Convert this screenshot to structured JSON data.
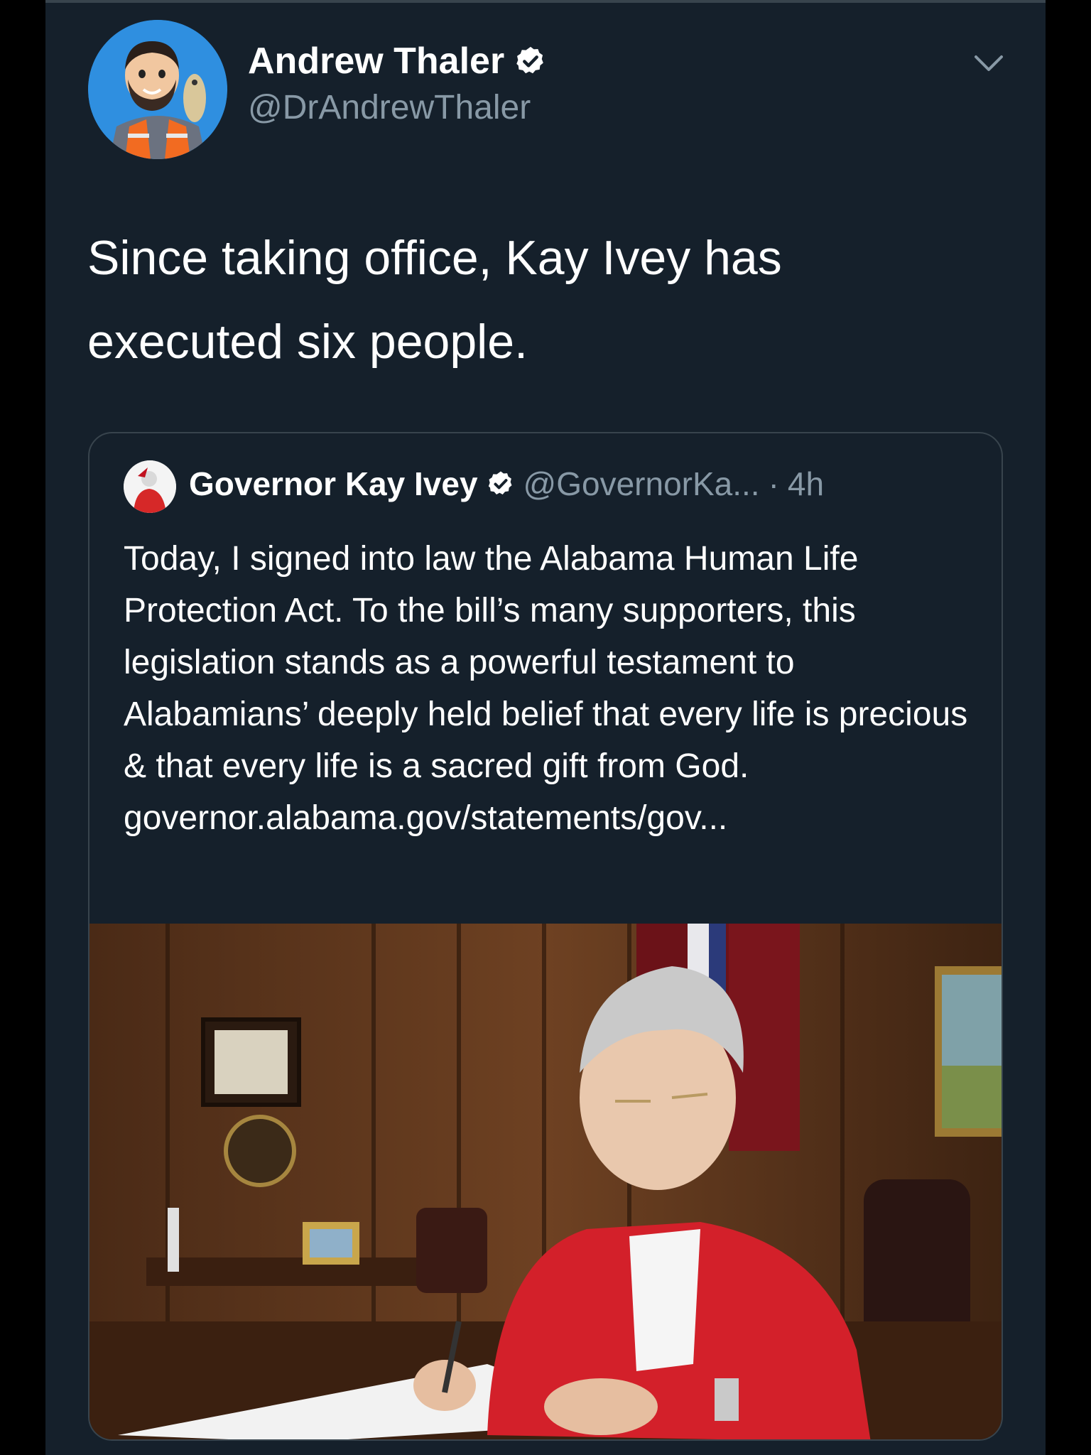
{
  "tweet": {
    "author_name": "Andrew Thaler",
    "author_handle": "@DrAndrewThaler",
    "text": "Since taking office, Kay Ivey has executed six people.",
    "avatar_icon": "cartoon-avatar",
    "verified_icon": "verified-badge-icon",
    "menu_icon": "chevron-down-icon"
  },
  "quoted_tweet": {
    "author_name": "Governor Kay Ivey",
    "author_handle": "@GovernorKa...",
    "separator": "·",
    "time": "4h",
    "text": "Today, I signed into law the Alabama Human Life Protection Act. To the bill’s many supporters, this legislation stands as a powerful testament to Alabamians’ deeply held belief that every life is precious & that every life is a sacred gift from God. governor.alabama.gov/statements/gov...",
    "media": "photo-governor-signing-bill"
  },
  "colors": {
    "background": "#15202b",
    "border": "#38444d",
    "text_primary": "#ffffff",
    "text_secondary": "#8899a6",
    "verified": "#ffffff"
  }
}
